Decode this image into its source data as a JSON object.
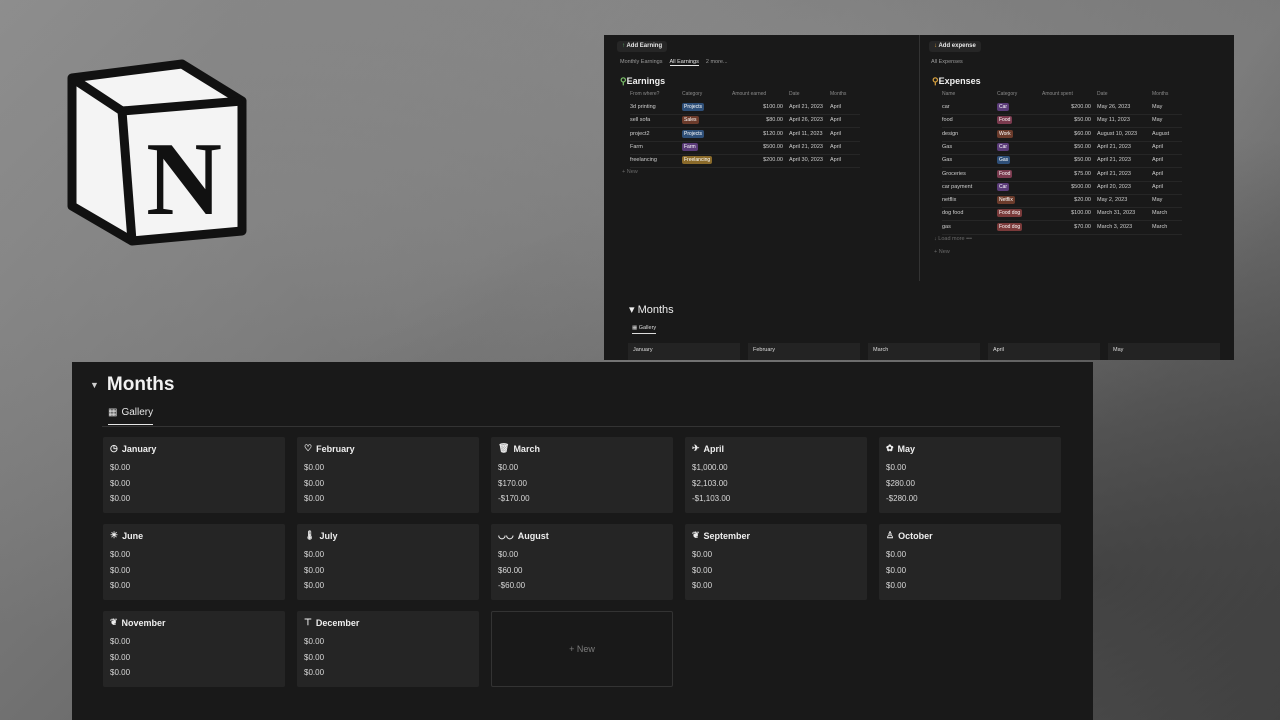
{
  "earnings": {
    "add_label": "Add Earning",
    "tabs": [
      "Monthly Earnings",
      "All Earnings",
      "2 more..."
    ],
    "title": "Earnings",
    "columns": [
      "From where?",
      "Category",
      "Amount earned",
      "Date",
      "Months"
    ],
    "rows": [
      {
        "name": "3d printing",
        "category": "Projects",
        "color": "#2e4f78",
        "amount": "$100.00",
        "date": "April 21, 2023",
        "month": "April"
      },
      {
        "name": "sell sofa",
        "category": "Sales",
        "color": "#6b3b2b",
        "amount": "$80.00",
        "date": "April 26, 2023",
        "month": "April"
      },
      {
        "name": "project2",
        "category": "Projects",
        "color": "#2e4f78",
        "amount": "$120.00",
        "date": "April 11, 2023",
        "month": "April"
      },
      {
        "name": "Farm",
        "category": "Farm",
        "color": "#5a3b78",
        "amount": "$500.00",
        "date": "April 21, 2023",
        "month": "April"
      },
      {
        "name": "freelancing",
        "category": "Freelancing",
        "color": "#8a6a2a",
        "amount": "$200.00",
        "date": "April 30, 2023",
        "month": "April"
      }
    ],
    "new_label": "New"
  },
  "expenses": {
    "add_label": "Add expense",
    "tabs": [
      "All Expenses"
    ],
    "title": "Expenses",
    "columns": [
      "Name",
      "Category",
      "Amount spent",
      "Date",
      "Months"
    ],
    "rows": [
      {
        "name": "car",
        "category": "Car",
        "color": "#5a3b78",
        "amount": "$200.00",
        "date": "May 26, 2023",
        "month": "May"
      },
      {
        "name": "food",
        "category": "Food",
        "color": "#7a3a4e",
        "amount": "$50.00",
        "date": "May 11, 2023",
        "month": "May"
      },
      {
        "name": "design",
        "category": "Work",
        "color": "#6b3b2b",
        "amount": "$60.00",
        "date": "August 10, 2023",
        "month": "August"
      },
      {
        "name": "Gas",
        "category": "Car",
        "color": "#5a3b78",
        "amount": "$50.00",
        "date": "April 21, 2023",
        "month": "April"
      },
      {
        "name": "Gas",
        "category": "Gas",
        "color": "#2e4f78",
        "amount": "$50.00",
        "date": "April 21, 2023",
        "month": "April"
      },
      {
        "name": "Groceries",
        "category": "Food",
        "color": "#7a3a4e",
        "amount": "$75.00",
        "date": "April 21, 2023",
        "month": "April"
      },
      {
        "name": "car payment",
        "category": "Car",
        "color": "#5a3b78",
        "amount": "$500.00",
        "date": "April 20, 2023",
        "month": "April"
      },
      {
        "name": "netflix",
        "category": "Netflix",
        "color": "#6b3b2b",
        "amount": "$20.00",
        "date": "May 2, 2023",
        "month": "May"
      },
      {
        "name": "dog food",
        "category": "Food dog",
        "color": "#7a3a3a",
        "amount": "$100.00",
        "date": "March 31, 2023",
        "month": "March"
      },
      {
        "name": "gas",
        "category": "Food dog",
        "color": "#7a3a3a",
        "amount": "$70.00",
        "date": "March 3, 2023",
        "month": "March"
      }
    ],
    "load_more": "Load more",
    "new_label": "New"
  },
  "small_months": {
    "title": "Months",
    "tab": "Gallery",
    "cards": [
      "January",
      "February",
      "March",
      "April",
      "May"
    ]
  },
  "months": {
    "title": "Months",
    "tab": "Gallery",
    "new_label": "New",
    "cards": [
      {
        "name": "January",
        "icon": "timer-icon",
        "v1": "$0.00",
        "v2": "$0.00",
        "v3": "$0.00"
      },
      {
        "name": "February",
        "icon": "heart-icon",
        "v1": "$0.00",
        "v2": "$0.00",
        "v3": "$0.00"
      },
      {
        "name": "March",
        "icon": "trash-icon",
        "v1": "$0.00",
        "v2": "$170.00",
        "v3": "-$170.00"
      },
      {
        "name": "April",
        "icon": "bird-icon",
        "v1": "$1,000.00",
        "v2": "$2,103.00",
        "v3": "-$1,103.00"
      },
      {
        "name": "May",
        "icon": "flower-icon",
        "v1": "$0.00",
        "v2": "$280.00",
        "v3": "-$280.00"
      },
      {
        "name": "June",
        "icon": "sun-icon",
        "v1": "$0.00",
        "v2": "$0.00",
        "v3": "$0.00"
      },
      {
        "name": "July",
        "icon": "thermometer-icon",
        "v1": "$0.00",
        "v2": "$0.00",
        "v3": "$0.00"
      },
      {
        "name": "August",
        "icon": "sunglasses-icon",
        "v1": "$0.00",
        "v2": "$60.00",
        "v3": "-$60.00"
      },
      {
        "name": "September",
        "icon": "leaf-icon",
        "v1": "$0.00",
        "v2": "$0.00",
        "v3": "$0.00"
      },
      {
        "name": "October",
        "icon": "ghost-icon",
        "v1": "$0.00",
        "v2": "$0.00",
        "v3": "$0.00"
      },
      {
        "name": "November",
        "icon": "leaf-icon",
        "v1": "$0.00",
        "v2": "$0.00",
        "v3": "$0.00"
      },
      {
        "name": "December",
        "icon": "tree-icon",
        "v1": "$0.00",
        "v2": "$0.00",
        "v3": "$0.00"
      }
    ]
  }
}
